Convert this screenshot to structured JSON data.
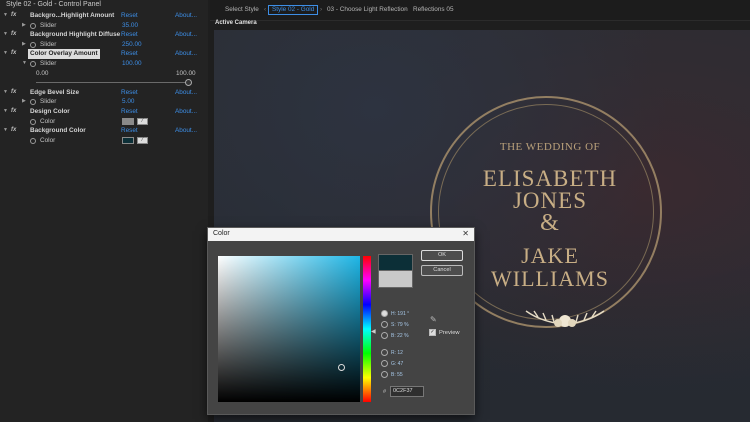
{
  "panel": {
    "title": "Style 02 - Gold - Control Panel",
    "fx_mark": "fx",
    "reset_label": "Reset",
    "about_label": "About...",
    "effects": [
      {
        "name": "Backgro...Highlight Amount",
        "sub_label": "Slider",
        "value": "35.00"
      },
      {
        "name": "Background Highlight Diffuse",
        "sub_label": "Slider",
        "value": "250.00"
      },
      {
        "name": "Color Overlay Amount",
        "sub_label": "Slider",
        "value": "100.00",
        "range_min": "0.00",
        "range_max": "100.00",
        "slider_fraction": 1.0
      },
      {
        "name": "Edge Bevel Size",
        "sub_label": "Slider",
        "value": "5.00"
      },
      {
        "name": "Design Color",
        "sub_label": "Color",
        "swatch_color": "#8a8a8a"
      },
      {
        "name": "Background Color",
        "sub_label": "Color",
        "swatch_color": "#0c2f37"
      }
    ]
  },
  "flowchart": {
    "crumbs": [
      "Select Style",
      "Style 02 - Gold",
      "03 - Choose Light Reflection",
      "Reflections 05"
    ]
  },
  "viewer": {
    "camera_label": "Active Camera",
    "kicker": "THE WEDDING OF",
    "name1": "ELISABETH",
    "name2": "JONES",
    "ampersand": "&",
    "name3": "JAKE",
    "name4": "WILLIAMS",
    "gold_color": "#c8ae85"
  },
  "color_dialog": {
    "title": "Color",
    "close_glyph": "✕",
    "ok_label": "OK",
    "cancel_label": "Cancel",
    "radios": [
      {
        "label": "H: 191 °",
        "selected": true
      },
      {
        "label": "S: 79 %",
        "selected": false
      },
      {
        "label": "B: 22 %",
        "selected": false
      },
      {
        "label": "R: 12",
        "selected": false
      },
      {
        "label": "G: 47",
        "selected": false
      },
      {
        "label": "B: 55",
        "selected": false
      }
    ],
    "hex_prefix": "#",
    "hex_value": "0C2F37",
    "preview_label": "Preview",
    "preview_checked": true,
    "new_color": "#0c2f37",
    "hue_color": "#1eb6e6"
  }
}
